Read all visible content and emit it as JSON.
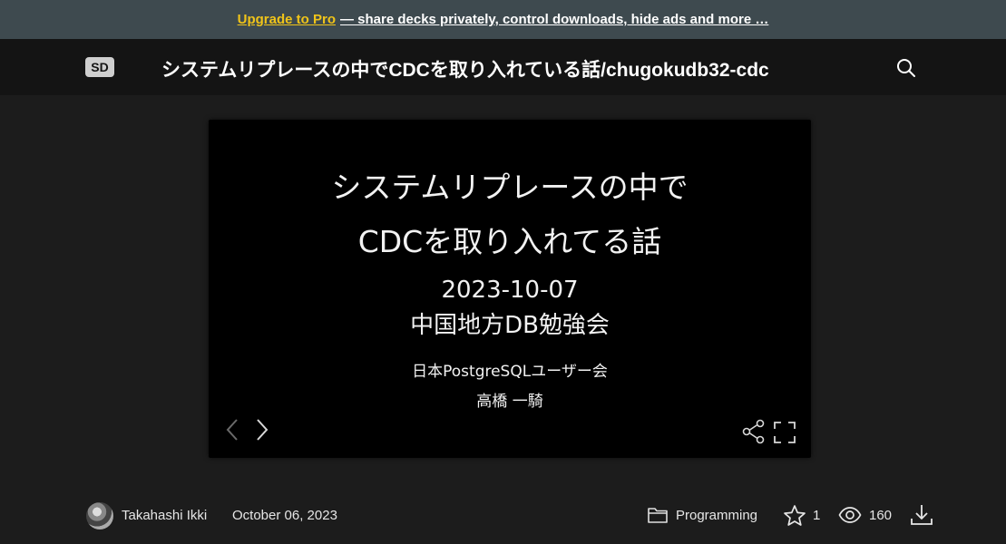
{
  "promo": {
    "upgrade_label": "Upgrade to Pro",
    "rest_label": "— share decks privately, control downloads, hide ads and more …"
  },
  "header": {
    "title": "システムリプレースの中でCDCを取り入れている話/chugokudb32-cdc",
    "logo_icon": "speakerdeck-logo",
    "search_icon": "search-icon"
  },
  "slide": {
    "title_line1": "システムリプレースの中で",
    "title_line2": "CDCを取り入れてる話",
    "date": "2023-10-07",
    "event": "中国地方DB勉強会",
    "org": "日本PostgreSQLユーザー会",
    "author": "高橋 一騎"
  },
  "footer": {
    "author": "Takahashi Ikki",
    "date": "October 06, 2023",
    "category": "Programming",
    "stars": "1",
    "views": "160"
  },
  "colors": {
    "promo_bg": "#3e4a4f",
    "pro_accent": "#f0c419",
    "header_bg": "#141414",
    "page_bg": "#1c1c1c",
    "slide_bg": "#000000"
  }
}
